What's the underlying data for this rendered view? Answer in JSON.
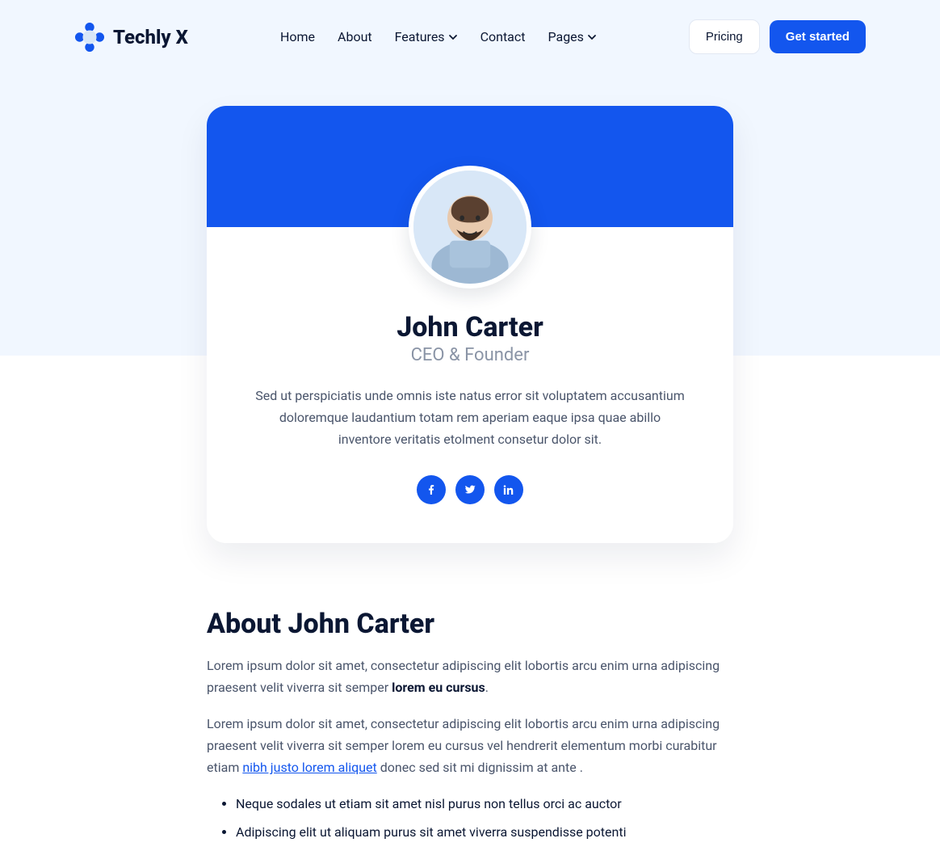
{
  "brand": {
    "name": "Techly X"
  },
  "nav": {
    "links": [
      {
        "label": "Home"
      },
      {
        "label": "About"
      },
      {
        "label": "Features",
        "hasDropdown": true
      },
      {
        "label": "Contact"
      },
      {
        "label": "Pages",
        "hasDropdown": true
      }
    ],
    "pricing": "Pricing",
    "cta": "Get started"
  },
  "person": {
    "name": "John Carter",
    "role": "CEO & Founder",
    "bio": "Sed ut perspiciatis unde omnis iste natus error sit voluptatem accusantium doloremque laudantium totam rem aperiam eaque ipsa quae abillo inventore veritatis etolment consetur dolor sit."
  },
  "socials": [
    {
      "name": "facebook"
    },
    {
      "name": "twitter"
    },
    {
      "name": "linkedin"
    }
  ],
  "about": {
    "heading": "About John Carter",
    "para1_a": "Lorem ipsum dolor sit amet, consectetur adipiscing elit lobortis arcu enim urna adipiscing praesent velit viverra sit semper ",
    "para1_strong": "lorem eu cursus",
    "para1_b": ".",
    "para2_a": "Lorem ipsum dolor sit amet, consectetur adipiscing elit lobortis arcu enim urna adipiscing praesent velit viverra sit semper lorem eu cursus vel hendrerit elementum morbi curabitur etiam ",
    "para2_link": "nibh justo lorem aliquet",
    "para2_b": " donec sed sit mi dignissim at ante .",
    "bullets": [
      "Neque sodales ut etiam sit amet nisl purus non tellus orci ac auctor",
      "Adipiscing elit ut aliquam purus sit amet viverra suspendisse potenti"
    ]
  },
  "colors": {
    "primary": "#1356ee"
  }
}
